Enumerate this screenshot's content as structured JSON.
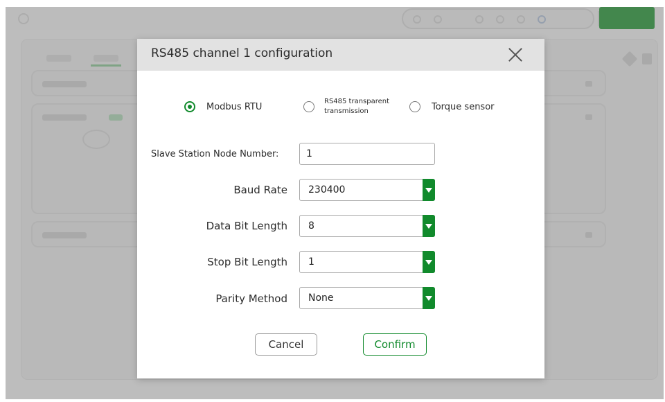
{
  "dialog": {
    "title": "RS485 channel 1 configuration",
    "protocol_options": [
      {
        "label": "Modbus RTU",
        "selected": true
      },
      {
        "label_line1": "RS485 transparent",
        "label_line2": "transmission",
        "selected": false
      },
      {
        "label": "Torque sensor",
        "selected": false
      }
    ],
    "fields": {
      "slave_node_label": "Slave Station Node Number:",
      "slave_node_value": "1",
      "baud_rate_label": "Baud Rate",
      "baud_rate_value": "230400",
      "data_bit_label": "Data Bit Length",
      "data_bit_value": "8",
      "stop_bit_label": "Stop Bit Length",
      "stop_bit_value": "1",
      "parity_label": "Parity Method",
      "parity_value": "None"
    },
    "cancel_label": "Cancel",
    "confirm_label": "Confirm"
  },
  "colors": {
    "accent": "#118a2c",
    "overlay": "rgba(128,128,128,0.48)",
    "header_bg": "#e2e2e2"
  },
  "icons": {
    "close": "close-icon",
    "dropdown": "chevron-down-icon"
  }
}
